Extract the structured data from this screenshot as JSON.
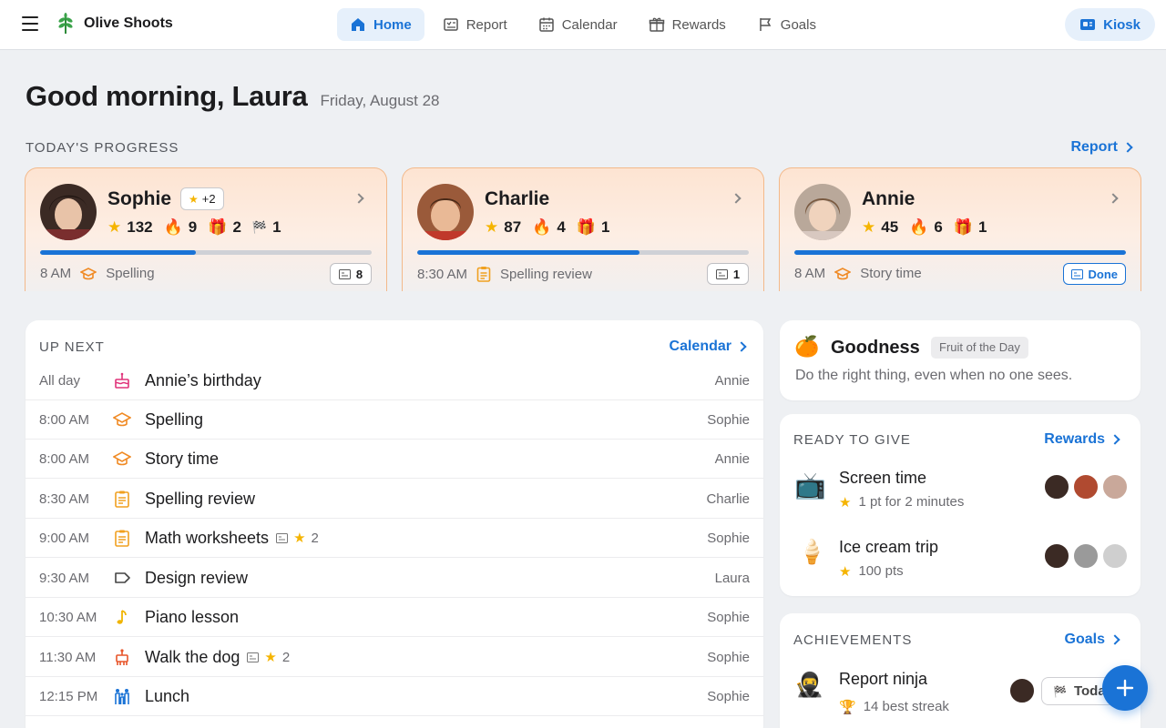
{
  "app": {
    "name": "Olive Shoots"
  },
  "nav": [
    {
      "label": "Home",
      "icon": "home-icon",
      "active": true
    },
    {
      "label": "Report",
      "icon": "report-icon"
    },
    {
      "label": "Calendar",
      "icon": "calendar-icon"
    },
    {
      "label": "Rewards",
      "icon": "rewards-icon"
    },
    {
      "label": "Goals",
      "icon": "flag-icon"
    }
  ],
  "kiosk": {
    "label": "Kiosk"
  },
  "greeting": {
    "title": "Good morning, Laura",
    "date": "Friday, August 28"
  },
  "progress": {
    "label": "TODAY'S PROGRESS",
    "link": "Report",
    "kids": [
      {
        "name": "Sophie",
        "bonus": "+2",
        "stars": "132",
        "streak": "9",
        "gifts": "2",
        "goals": "1",
        "progress": 0.47,
        "time": "8 AM",
        "activity": "Spelling",
        "count": "8"
      },
      {
        "name": "Charlie",
        "stars": "87",
        "streak": "4",
        "gifts": "1",
        "progress": 0.67,
        "time": "8:30 AM",
        "activity": "Spelling review",
        "count": "1"
      },
      {
        "name": "Annie",
        "stars": "45",
        "streak": "6",
        "gifts": "1",
        "progress": 1.0,
        "time": "8 AM",
        "activity": "Story time",
        "count": "Done"
      }
    ]
  },
  "upnext": {
    "label": "UP NEXT",
    "link": "Calendar",
    "rows": [
      {
        "time": "All day",
        "title": "Annie’s birthday",
        "who": "Annie",
        "icon": "cake-icon"
      },
      {
        "time": "8:00 AM",
        "title": "Spelling",
        "who": "Sophie",
        "icon": "graduation-cap-icon"
      },
      {
        "time": "8:00 AM",
        "title": "Story time",
        "who": "Annie",
        "icon": "graduation-cap-icon"
      },
      {
        "time": "8:30 AM",
        "title": "Spelling review",
        "who": "Charlie",
        "icon": "clipboard-icon"
      },
      {
        "time": "9:00 AM",
        "title": "Math worksheets",
        "points": "2",
        "who": "Sophie",
        "icon": "clipboard-icon"
      },
      {
        "time": "9:30 AM",
        "title": "Design review",
        "who": "Laura",
        "icon": "tag-icon"
      },
      {
        "time": "10:30 AM",
        "title": "Piano lesson",
        "who": "Sophie",
        "icon": "music-note-icon"
      },
      {
        "time": "11:30 AM",
        "title": "Walk the dog",
        "points": "2",
        "who": "Sophie",
        "icon": "walk-icon"
      },
      {
        "time": "12:15 PM",
        "title": "Lunch",
        "who": "Sophie",
        "icon": "family-icon"
      }
    ]
  },
  "goodness": {
    "title": "Goodness",
    "badge": "Fruit of the Day",
    "text": "Do the right thing, even when no one sees."
  },
  "ready": {
    "label": "READY TO GIVE",
    "link": "Rewards",
    "items": [
      {
        "title": "Screen time",
        "sub": "1 pt for 2 minutes",
        "icon": "tv-icon"
      },
      {
        "title": "Ice cream trip",
        "sub": "100 pts",
        "icon": "ice-cream-icon"
      }
    ]
  },
  "achievements": {
    "label": "ACHIEVEMENTS",
    "link": "Goals",
    "items": [
      {
        "title": "Report ninja",
        "sub": "14 best streak",
        "tag": "Today",
        "icon": "ninja-icon"
      }
    ]
  }
}
